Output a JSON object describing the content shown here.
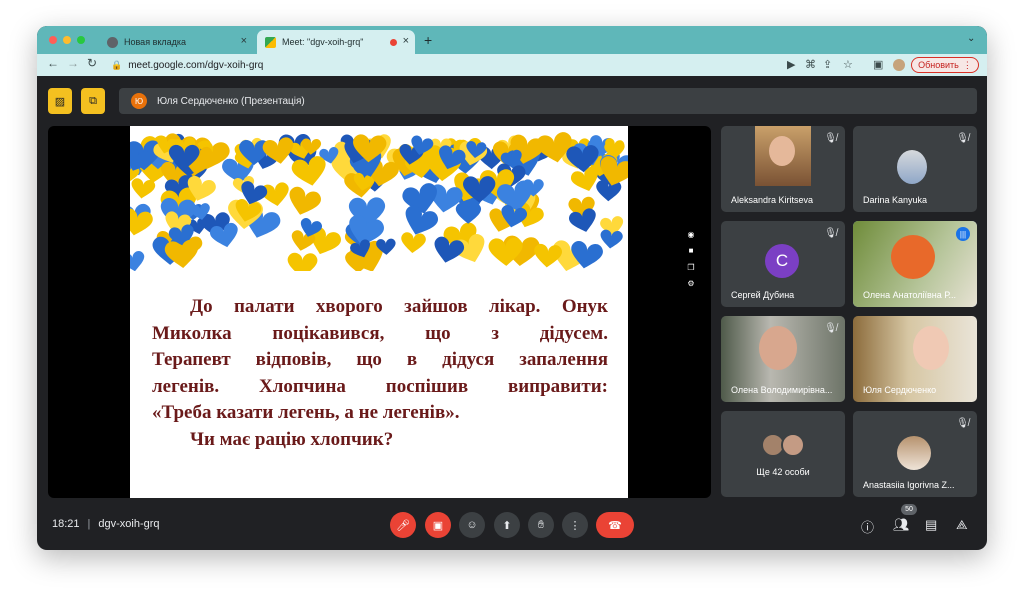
{
  "browser": {
    "tabs": [
      {
        "title": "Новая вкладка",
        "close": "×"
      },
      {
        "title": "Meet: \"dgv-xoih-grq\"",
        "close": "×"
      }
    ],
    "new_tab": "+",
    "url": "meet.google.com/dgv-xoih-grq",
    "update_label": "Обновить",
    "colors": {
      "tabstrip": "#5fb7b9",
      "toolbar": "#d5eff0"
    }
  },
  "presentation": {
    "presenter_initial": "Ю",
    "presenter_label": "Юля Сердюченко (Презентація)"
  },
  "slide": {
    "paragraphs": [
      "До палати хворого зайшов лікар. Онук",
      "Миколка поцікавився, що з дідусем.",
      "Терапевт відповів, що в дідуся запалення",
      "легенів. Хлопчина поспішив виправити:",
      "«Треба казати легень, а не легенів».",
      "Чи має рацію хлопчик?"
    ]
  },
  "participants": [
    {
      "name": "Aleksandra Kiritseva",
      "muted": true
    },
    {
      "name": "Darina Kanyuka",
      "muted": true
    },
    {
      "name": "Сергей Дубина",
      "initial": "С",
      "muted": true
    },
    {
      "name": "Олена Анатоліївна Р...",
      "speaking": true
    },
    {
      "name": "Олена Володимирівна...",
      "muted": true
    },
    {
      "name": "Юля Сердюченко",
      "muted": false
    },
    {
      "name": "Ще 42 особи",
      "muted": false
    },
    {
      "name": "Anastasiia Igorivna Z...",
      "muted": true
    }
  ],
  "meeting": {
    "time": "18:21",
    "code": "dgv-xoih-grq",
    "people_count": "50"
  }
}
